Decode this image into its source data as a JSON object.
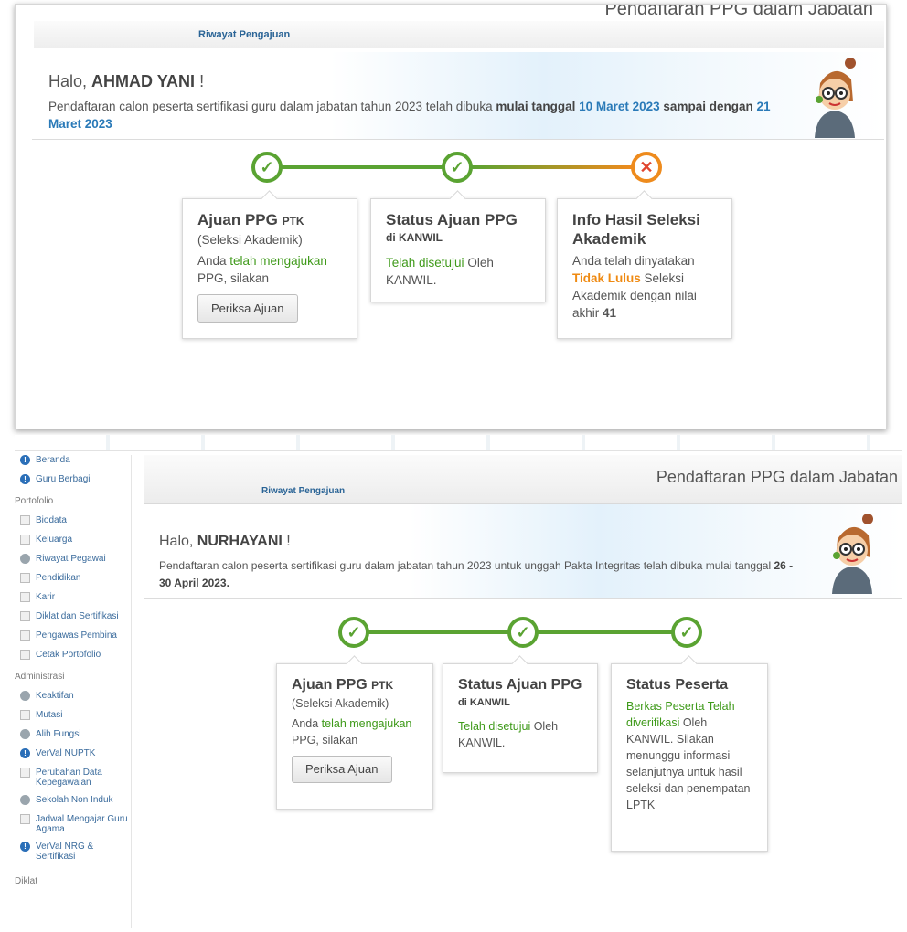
{
  "top": {
    "tab_label": "Riwayat Pengajuan",
    "cut_title": "Pendaftaran PPG dalam Jabatan",
    "greeting_prefix": "Halo, ",
    "greeting_name": "AHMAD YANI",
    "greeting_suffix": " !",
    "notice": {
      "t1": "Pendaftaran calon peserta sertifikasi guru dalam jabatan tahun 2023 telah dibuka ",
      "t2": "mulai tanggal ",
      "t3": "10 Maret 2023",
      "t4": " sampai dengan ",
      "t5": "21 Maret 2023"
    },
    "steps": [
      "done",
      "done",
      "failed"
    ],
    "cards": {
      "c1": {
        "title": "Ajuan PPG ",
        "title_small": "PTK",
        "subtitle": "(Seleksi Akademik)",
        "text_a": "Anda ",
        "text_b": "telah mengajukan",
        "text_c": " PPG, silakan",
        "button": "Periksa Ajuan"
      },
      "c2": {
        "title": "Status Ajuan PPG",
        "sub": "di KANWIL",
        "text_a": "Telah disetujui",
        "text_b": " Oleh KANWIL."
      },
      "c3": {
        "title": "Info Hasil Seleksi Akademik",
        "text_a": "Anda telah dinyatakan ",
        "text_b": "Tidak Lulus",
        "text_c": " Seleksi Akademik dengan nilai akhir ",
        "text_d": "41"
      }
    }
  },
  "bottom": {
    "page_title": "Pendaftaran PPG dalam Jabatan",
    "tab_label": "Riwayat Pengajuan",
    "greeting_prefix": "Halo, ",
    "greeting_name": "NURHAYANI",
    "greeting_suffix": " !",
    "notice": {
      "t1": "Pendaftaran calon peserta sertifikasi guru dalam jabatan tahun 2023 untuk unggah Pakta Integritas telah dibuka mulai tanggal ",
      "t2": "26 - 30 April 2023."
    },
    "steps": [
      "done",
      "done",
      "done"
    ],
    "cards": {
      "c1": {
        "title": "Ajuan PPG ",
        "title_small": "PTK",
        "subtitle": "(Seleksi Akademik)",
        "text_a": "Anda ",
        "text_b": "telah mengajukan",
        "text_c": " PPG, silakan",
        "button": "Periksa Ajuan"
      },
      "c2": {
        "title": "Status Ajuan PPG",
        "sub": "di KANWIL",
        "text_a": "Telah disetujui",
        "text_b": " Oleh KANWIL."
      },
      "c3": {
        "title": "Status Peserta",
        "text_a": "Berkas Peserta Telah diverifikasi",
        "text_b": " Oleh KANWIL. Silakan menunggu informasi selanjutnya untuk hasil seleksi dan penempatan LPTK"
      }
    },
    "sidebar": {
      "top_items": [
        {
          "label": "Beranda",
          "icon": "info-icon"
        },
        {
          "label": "Guru Berbagi",
          "icon": "info-icon"
        }
      ],
      "section_portfolio": "Portofolio",
      "portfolio_items": [
        {
          "label": "Biodata",
          "icon": "document-icon"
        },
        {
          "label": "Keluarga",
          "icon": "document-icon"
        },
        {
          "label": "Riwayat Pegawai",
          "icon": "clock-icon"
        },
        {
          "label": "Pendidikan",
          "icon": "document-icon"
        },
        {
          "label": "Karir",
          "icon": "document-icon"
        },
        {
          "label": "Diklat dan Sertifikasi",
          "icon": "document-icon"
        },
        {
          "label": "Pengawas Pembina",
          "icon": "document-icon"
        },
        {
          "label": "Cetak Portofolio",
          "icon": "document-icon"
        }
      ],
      "section_admin": "Administrasi",
      "admin_items": [
        {
          "label": "Keaktifan",
          "icon": "gear-icon"
        },
        {
          "label": "Mutasi",
          "icon": "folder-icon"
        },
        {
          "label": "Alih Fungsi",
          "icon": "user-icon"
        },
        {
          "label": "VerVal NUPTK",
          "icon": "info-icon"
        },
        {
          "label": "Perubahan Data Kepegawaian",
          "icon": "document-icon"
        },
        {
          "label": "Sekolah Non Induk",
          "icon": "school-icon"
        },
        {
          "label": "Jadwal Mengajar Guru Agama",
          "icon": "document-icon"
        },
        {
          "label": "VerVal NRG & Sertifikasi",
          "icon": "info-icon"
        }
      ],
      "section_diklat": "Diklat"
    }
  },
  "colors": {
    "accent_green": "#5aa332",
    "accent_orange": "#ee8b1d",
    "fail_red": "#e0452f",
    "link_blue": "#2a7ab8"
  }
}
